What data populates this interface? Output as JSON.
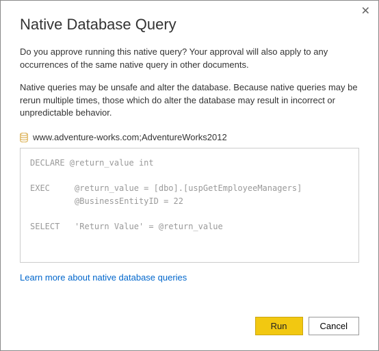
{
  "dialog": {
    "title": "Native Database Query",
    "close_glyph": "✕",
    "paragraph1": "Do you approve running this native query? Your approval will also apply to any occurrences of the same native query in other documents.",
    "paragraph2": "Native queries may be unsafe and alter the database. Because native queries may be rerun multiple times, those which do alter the database may result in incorrect or unpredictable behavior.",
    "database_name": "www.adventure-works.com;AdventureWorks2012",
    "db_icon_color": "#d6a43a",
    "query_text": "DECLARE @return_value int\n\nEXEC     @return_value = [dbo].[uspGetEmployeeManagers]\n         @BusinessEntityID = 22\n\nSELECT   'Return Value' = @return_value",
    "learn_more_label": "Learn more about native database queries",
    "run_label": "Run",
    "cancel_label": "Cancel"
  }
}
